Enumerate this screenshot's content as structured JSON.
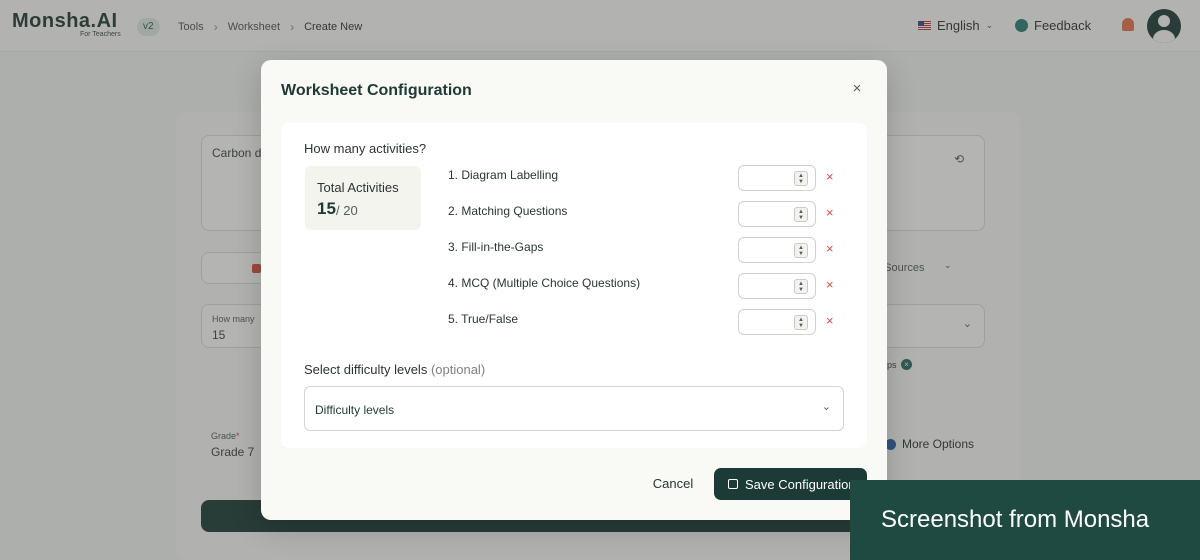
{
  "topbar": {
    "logo": "Monsha.AI",
    "logo_sub": "For Teachers",
    "version": "v2",
    "breadcrumbs": [
      "Tools",
      "Worksheet",
      "Create New"
    ],
    "language": "English",
    "feedback": "Feedback"
  },
  "background": {
    "topic_value": "Carbon d",
    "sources_label": "e Sources",
    "how_many_label": "How many",
    "how_many_value": "15",
    "chip_fragment": "ps",
    "grade_label": "Grade",
    "grade_value": "Grade 7",
    "more_options": "More Options"
  },
  "modal": {
    "title": "Worksheet Configuration",
    "close_glyph": "×",
    "activities_question": "How many activities?",
    "total": {
      "label": "Total Activities",
      "count": "15",
      "max": "/ 20"
    },
    "activities": [
      {
        "label": "1. Diagram Labelling",
        "value": ""
      },
      {
        "label": "2. Matching Questions",
        "value": ""
      },
      {
        "label": "3. Fill-in-the-Gaps",
        "value": ""
      },
      {
        "label": "4. MCQ (Multiple Choice Questions)",
        "value": ""
      },
      {
        "label": "5. True/False",
        "value": ""
      }
    ],
    "difficulty": {
      "label": "Select difficulty levels",
      "optional": "(optional)",
      "placeholder": "Difficulty levels"
    },
    "cancel_label": "Cancel",
    "save_label": "Save Configuration"
  },
  "watermark": "Screenshot from Monsha",
  "colors": {
    "brand_dark": "#1c3b36",
    "remove_red": "#e04b4b",
    "watermark_bg": "#1f4a42"
  }
}
